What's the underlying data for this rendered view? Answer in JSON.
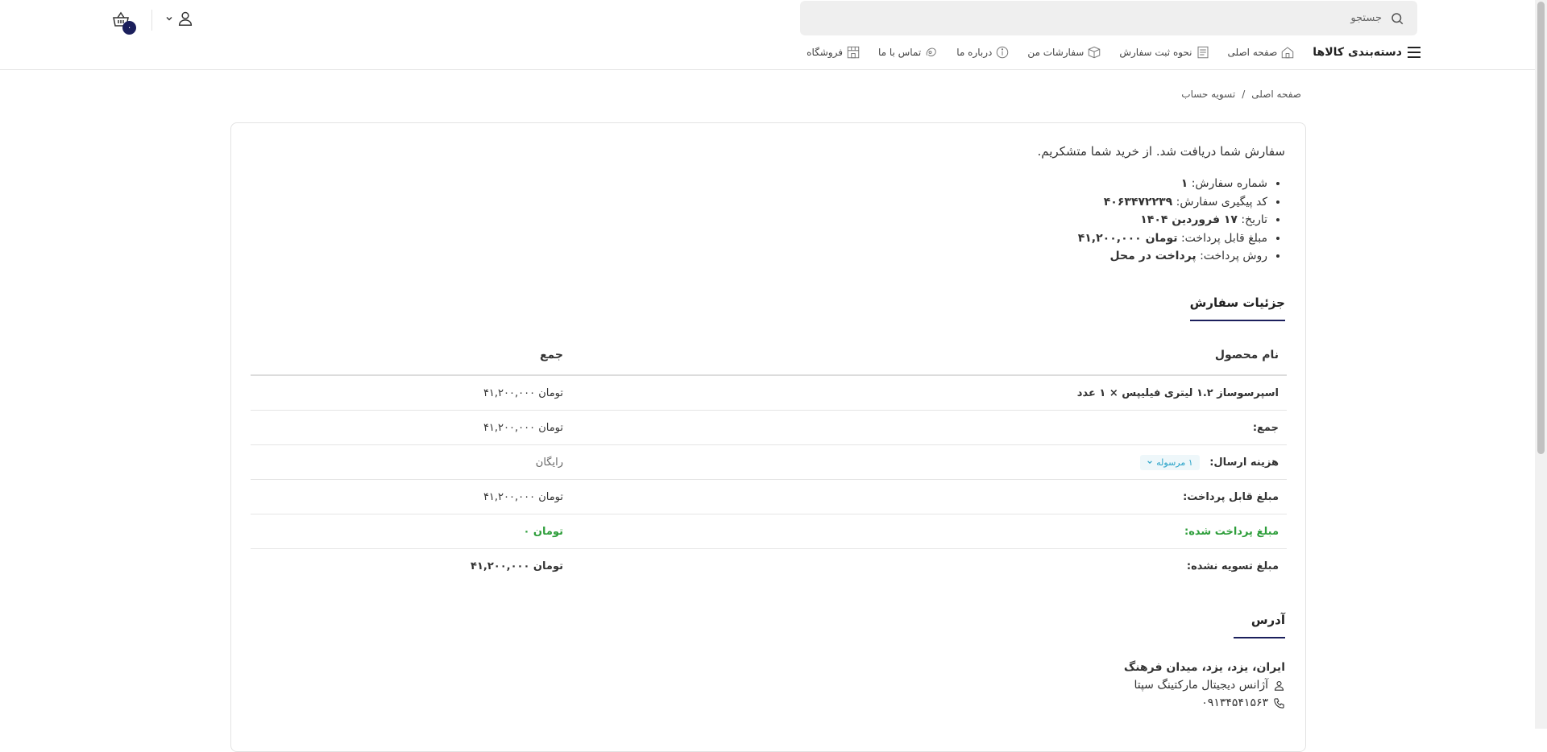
{
  "header": {
    "search_placeholder": "جستجو",
    "cart_count": "۰"
  },
  "nav": {
    "categories": "دسته‌بندی کالاها",
    "items": [
      {
        "label": "صفحه اصلی",
        "icon": "home-icon"
      },
      {
        "label": "نحوه ثبت سفارش",
        "icon": "document-icon"
      },
      {
        "label": "سفارشات من",
        "icon": "box-icon"
      },
      {
        "label": "درباره ما",
        "icon": "info-icon"
      },
      {
        "label": "تماس با ما",
        "icon": "contact-icon"
      },
      {
        "label": "فروشگاه",
        "icon": "store-icon"
      }
    ]
  },
  "breadcrumb": {
    "home": "صفحه اصلی",
    "sep": "/",
    "current": "تسویه حساب"
  },
  "order": {
    "thanks": "سفارش شما دریافت شد. از خرید شما متشکریم.",
    "number_label": "شماره سفارش:",
    "number": "۱",
    "tracking_label": "کد پیگیری سفارش:",
    "tracking": "۴۰۶۳۴۷۲۲۳۹",
    "date_label": "تاریخ:",
    "date": "۱۷ فروردین ۱۴۰۴",
    "total_label": "مبلغ قابل پرداخت:",
    "total": "تومان ۴۱,۲۰۰,۰۰۰",
    "method_label": "روش پرداخت:",
    "method": "پرداخت در محل"
  },
  "details": {
    "title": "جزئیات سفارش",
    "col_product": "نام محصول",
    "col_total": "جمع",
    "product_name": "اسپرسوساز ۱.۲ لیتری فیلیپس × ۱ عدد",
    "product_total": "تومان ۴۱,۲۰۰,۰۰۰",
    "subtotal_label": "جمع:",
    "subtotal": "تومان ۴۱,۲۰۰,۰۰۰",
    "shipping_label": "هزینه ارسال:",
    "shipping_tag": "۱ مرسوله",
    "shipping": "رایگان",
    "payable_label": "مبلغ قابل پرداخت:",
    "payable": "تومان ۴۱,۲۰۰,۰۰۰",
    "paid_label": "مبلغ پرداخت شده:",
    "paid": "تومان ۰",
    "unpaid_label": "مبلغ تسویه نشده:",
    "unpaid": "تومان ۴۱,۲۰۰,۰۰۰"
  },
  "address": {
    "title": "آدرس",
    "line": "ایران، یزد، یزد، میدان فرهنگ",
    "name": "آژانس دیجیتال مارکتینگ سپتا",
    "phone": "۰۹۱۳۴۵۴۱۵۶۳"
  },
  "colors": {
    "accent": "#1b1f5c",
    "green": "#2e9e3b",
    "tag": "#2aa3c8"
  }
}
